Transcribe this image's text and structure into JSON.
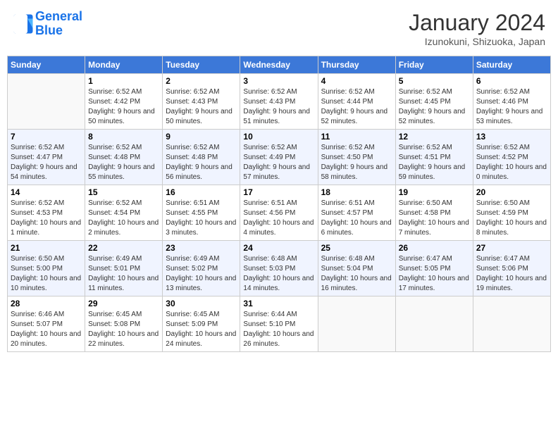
{
  "header": {
    "logo_line1": "General",
    "logo_line2": "Blue",
    "month": "January 2024",
    "location": "Izunokuni, Shizuoka, Japan"
  },
  "days_of_week": [
    "Sunday",
    "Monday",
    "Tuesday",
    "Wednesday",
    "Thursday",
    "Friday",
    "Saturday"
  ],
  "weeks": [
    [
      {
        "day": "",
        "sunrise": "",
        "sunset": "",
        "daylight": ""
      },
      {
        "day": "1",
        "sunrise": "Sunrise: 6:52 AM",
        "sunset": "Sunset: 4:42 PM",
        "daylight": "Daylight: 9 hours and 50 minutes."
      },
      {
        "day": "2",
        "sunrise": "Sunrise: 6:52 AM",
        "sunset": "Sunset: 4:43 PM",
        "daylight": "Daylight: 9 hours and 50 minutes."
      },
      {
        "day": "3",
        "sunrise": "Sunrise: 6:52 AM",
        "sunset": "Sunset: 4:43 PM",
        "daylight": "Daylight: 9 hours and 51 minutes."
      },
      {
        "day": "4",
        "sunrise": "Sunrise: 6:52 AM",
        "sunset": "Sunset: 4:44 PM",
        "daylight": "Daylight: 9 hours and 52 minutes."
      },
      {
        "day": "5",
        "sunrise": "Sunrise: 6:52 AM",
        "sunset": "Sunset: 4:45 PM",
        "daylight": "Daylight: 9 hours and 52 minutes."
      },
      {
        "day": "6",
        "sunrise": "Sunrise: 6:52 AM",
        "sunset": "Sunset: 4:46 PM",
        "daylight": "Daylight: 9 hours and 53 minutes."
      }
    ],
    [
      {
        "day": "7",
        "sunrise": "Sunrise: 6:52 AM",
        "sunset": "Sunset: 4:47 PM",
        "daylight": "Daylight: 9 hours and 54 minutes."
      },
      {
        "day": "8",
        "sunrise": "Sunrise: 6:52 AM",
        "sunset": "Sunset: 4:48 PM",
        "daylight": "Daylight: 9 hours and 55 minutes."
      },
      {
        "day": "9",
        "sunrise": "Sunrise: 6:52 AM",
        "sunset": "Sunset: 4:48 PM",
        "daylight": "Daylight: 9 hours and 56 minutes."
      },
      {
        "day": "10",
        "sunrise": "Sunrise: 6:52 AM",
        "sunset": "Sunset: 4:49 PM",
        "daylight": "Daylight: 9 hours and 57 minutes."
      },
      {
        "day": "11",
        "sunrise": "Sunrise: 6:52 AM",
        "sunset": "Sunset: 4:50 PM",
        "daylight": "Daylight: 9 hours and 58 minutes."
      },
      {
        "day": "12",
        "sunrise": "Sunrise: 6:52 AM",
        "sunset": "Sunset: 4:51 PM",
        "daylight": "Daylight: 9 hours and 59 minutes."
      },
      {
        "day": "13",
        "sunrise": "Sunrise: 6:52 AM",
        "sunset": "Sunset: 4:52 PM",
        "daylight": "Daylight: 10 hours and 0 minutes."
      }
    ],
    [
      {
        "day": "14",
        "sunrise": "Sunrise: 6:52 AM",
        "sunset": "Sunset: 4:53 PM",
        "daylight": "Daylight: 10 hours and 1 minute."
      },
      {
        "day": "15",
        "sunrise": "Sunrise: 6:52 AM",
        "sunset": "Sunset: 4:54 PM",
        "daylight": "Daylight: 10 hours and 2 minutes."
      },
      {
        "day": "16",
        "sunrise": "Sunrise: 6:51 AM",
        "sunset": "Sunset: 4:55 PM",
        "daylight": "Daylight: 10 hours and 3 minutes."
      },
      {
        "day": "17",
        "sunrise": "Sunrise: 6:51 AM",
        "sunset": "Sunset: 4:56 PM",
        "daylight": "Daylight: 10 hours and 4 minutes."
      },
      {
        "day": "18",
        "sunrise": "Sunrise: 6:51 AM",
        "sunset": "Sunset: 4:57 PM",
        "daylight": "Daylight: 10 hours and 6 minutes."
      },
      {
        "day": "19",
        "sunrise": "Sunrise: 6:50 AM",
        "sunset": "Sunset: 4:58 PM",
        "daylight": "Daylight: 10 hours and 7 minutes."
      },
      {
        "day": "20",
        "sunrise": "Sunrise: 6:50 AM",
        "sunset": "Sunset: 4:59 PM",
        "daylight": "Daylight: 10 hours and 8 minutes."
      }
    ],
    [
      {
        "day": "21",
        "sunrise": "Sunrise: 6:50 AM",
        "sunset": "Sunset: 5:00 PM",
        "daylight": "Daylight: 10 hours and 10 minutes."
      },
      {
        "day": "22",
        "sunrise": "Sunrise: 6:49 AM",
        "sunset": "Sunset: 5:01 PM",
        "daylight": "Daylight: 10 hours and 11 minutes."
      },
      {
        "day": "23",
        "sunrise": "Sunrise: 6:49 AM",
        "sunset": "Sunset: 5:02 PM",
        "daylight": "Daylight: 10 hours and 13 minutes."
      },
      {
        "day": "24",
        "sunrise": "Sunrise: 6:48 AM",
        "sunset": "Sunset: 5:03 PM",
        "daylight": "Daylight: 10 hours and 14 minutes."
      },
      {
        "day": "25",
        "sunrise": "Sunrise: 6:48 AM",
        "sunset": "Sunset: 5:04 PM",
        "daylight": "Daylight: 10 hours and 16 minutes."
      },
      {
        "day": "26",
        "sunrise": "Sunrise: 6:47 AM",
        "sunset": "Sunset: 5:05 PM",
        "daylight": "Daylight: 10 hours and 17 minutes."
      },
      {
        "day": "27",
        "sunrise": "Sunrise: 6:47 AM",
        "sunset": "Sunset: 5:06 PM",
        "daylight": "Daylight: 10 hours and 19 minutes."
      }
    ],
    [
      {
        "day": "28",
        "sunrise": "Sunrise: 6:46 AM",
        "sunset": "Sunset: 5:07 PM",
        "daylight": "Daylight: 10 hours and 20 minutes."
      },
      {
        "day": "29",
        "sunrise": "Sunrise: 6:45 AM",
        "sunset": "Sunset: 5:08 PM",
        "daylight": "Daylight: 10 hours and 22 minutes."
      },
      {
        "day": "30",
        "sunrise": "Sunrise: 6:45 AM",
        "sunset": "Sunset: 5:09 PM",
        "daylight": "Daylight: 10 hours and 24 minutes."
      },
      {
        "day": "31",
        "sunrise": "Sunrise: 6:44 AM",
        "sunset": "Sunset: 5:10 PM",
        "daylight": "Daylight: 10 hours and 26 minutes."
      },
      {
        "day": "",
        "sunrise": "",
        "sunset": "",
        "daylight": ""
      },
      {
        "day": "",
        "sunrise": "",
        "sunset": "",
        "daylight": ""
      },
      {
        "day": "",
        "sunrise": "",
        "sunset": "",
        "daylight": ""
      }
    ]
  ]
}
